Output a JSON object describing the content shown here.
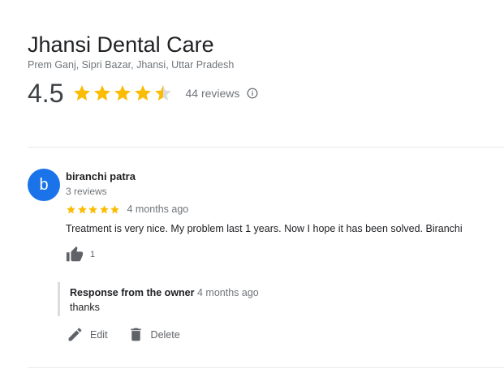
{
  "business": {
    "name": "Jhansi Dental Care",
    "address": "Prem Ganj, Sipri Bazar, Jhansi, Uttar Pradesh",
    "rating": "4.5",
    "rating_value": 4.5,
    "reviews_count": "44 reviews"
  },
  "review": {
    "avatar_letter": "b",
    "avatar_color": "#1a73e8",
    "reviewer_name": "biranchi patra",
    "reviewer_reviews": "3 reviews",
    "stars": 5,
    "date": "4 months ago",
    "text": "Treatment is very nice. My problem last 1 years. Now I hope it has been solved. Biranchi",
    "likes": "1"
  },
  "response": {
    "title": "Response from the owner",
    "date": "4 months ago",
    "text": "thanks"
  },
  "actions": {
    "edit_label": "Edit",
    "delete_label": "Delete"
  },
  "colors": {
    "star": "#fbbc04",
    "star_empty": "#dadce0",
    "icon_gray": "#5f6368"
  },
  "icons": {
    "info": "info-icon",
    "like": "thumb-up-icon",
    "edit": "pencil-icon",
    "delete": "trash-icon"
  }
}
